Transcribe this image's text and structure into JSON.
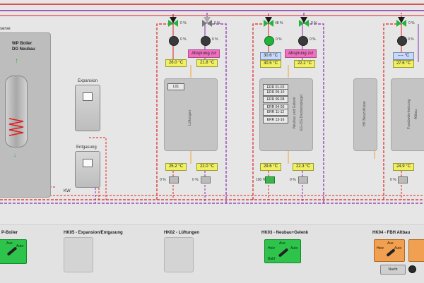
{
  "scene": {
    "boiler": {
      "partial_label": "serve",
      "title_line1": "WP Boiler",
      "title_line2": "DG Neubau"
    },
    "expansion_label": "Expansion",
    "degassing_label": "Entgasung",
    "kw_label": "KW",
    "groups": [
      {
        "id": "hk02",
        "valve_top_left_pct": "0 %",
        "valve_top_right_pct": "0 %",
        "pump_left_pct": "0 %",
        "pump_right_pct": "0 %",
        "jump_label": "Absprung zu!",
        "temp_left": "26.0 °C",
        "temp_right": "21.8 °C",
        "panel_header": "L01",
        "panel_vertical": "Lüftungen",
        "temp_bottom_left": "25.2 °C",
        "temp_bottom_right": "22.0 °C",
        "valve_bottom_left_pct": "0 %",
        "valve_bottom_right_pct": "0 %"
      },
      {
        "id": "hk03",
        "valve_top_left_pct": "48 %",
        "valve_top_right_pct": "0 %",
        "pump_left_pct": "0 %",
        "pump_right_pct": "0 %",
        "jump_label": "Absprung zu!",
        "temp_left_top": "30.6 °C",
        "temp_left": "30.5 °C",
        "temp_right": "22.2 °C",
        "err_items": [
          "ERR 01-03",
          "ERR 09-10",
          "ERR 06-08",
          "ERR 04-05",
          "ERR 11-12",
          "ERR 13-16"
        ],
        "panel_vertical_1": "Neubau und Gelenk",
        "panel_vertical_2": "EG-OG Deckenspiegel",
        "temp_bottom_left": "29.6 °C",
        "temp_bottom_right": "22.3 °C",
        "valve_bottom_left_pct": "100 %",
        "valve_bottom_right_pct": "0 %"
      },
      {
        "id": "hk04",
        "valve_top_left_pct": "0 %",
        "pump_left_pct": "0 %",
        "temp_left_top": "---- °C",
        "temp_left": "27.6 °C",
        "small_panel_vertical": "HK Neuzuflüsse",
        "panel_vertical_1": "Fussbodenheizung",
        "panel_vertical_2": "Altbau",
        "temp_bottom_left": "24.9 °C",
        "valve_bottom_left_pct": "0 %"
      }
    ]
  },
  "bottom": {
    "sections": [
      {
        "title": "P-Boiler"
      },
      {
        "title": "HK05 - Expansion/Entgasung"
      },
      {
        "title": "HK02 - Lüftungen"
      },
      {
        "title": "HK03 - Neubau+Gelenk"
      },
      {
        "title": "HK04 - FBH Altbau"
      }
    ],
    "switch_labels": {
      "aus": "Aus",
      "heiz": "Heiz",
      "auto": "Auto",
      "bald": "Bald"
    },
    "night_button": "Nacht"
  },
  "colors": {
    "supply": "#e02020",
    "return": "#8a2bb0",
    "heat_source": "#e02020",
    "active": "#22b43a",
    "jump": "#f070c0"
  }
}
